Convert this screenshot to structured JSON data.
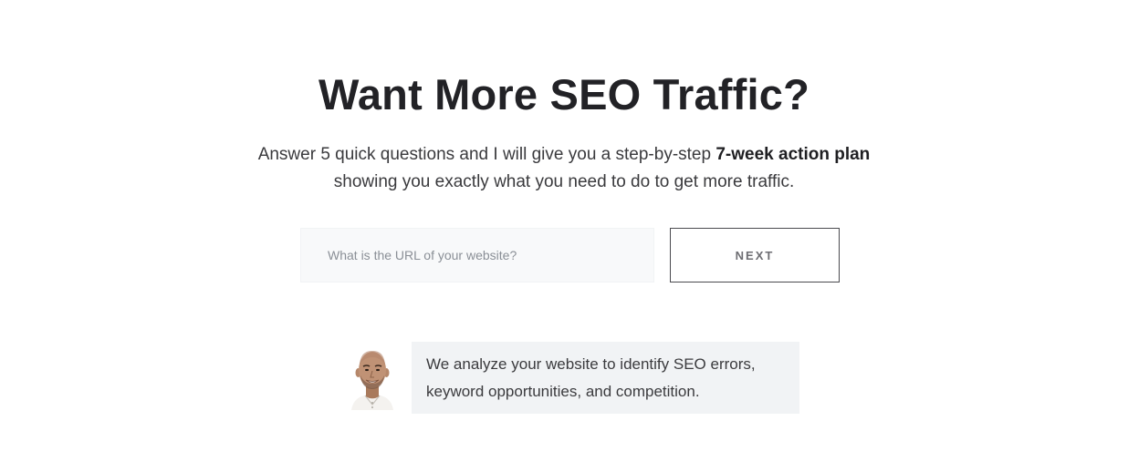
{
  "hero": {
    "headline": "Want More SEO Traffic?",
    "subtext_part1": "Answer 5 quick questions and I will give you a step-by-step ",
    "subtext_bold": "7-week action plan",
    "subtext_part2": "showing you exactly what you need to do to get more traffic."
  },
  "form": {
    "url_placeholder": "What is the URL of your website?",
    "url_value": "",
    "next_label": "NEXT"
  },
  "testimonial": {
    "avatar_icon": "person-portrait-icon",
    "line1": "We analyze your website to identify SEO errors,",
    "line2": "keyword opportunities, and competition."
  },
  "colors": {
    "background": "#ffffff",
    "headline": "#222226",
    "input_bg": "#f8f9fa",
    "bubble_bg": "#f1f3f5",
    "button_border": "#4a4a4f"
  }
}
